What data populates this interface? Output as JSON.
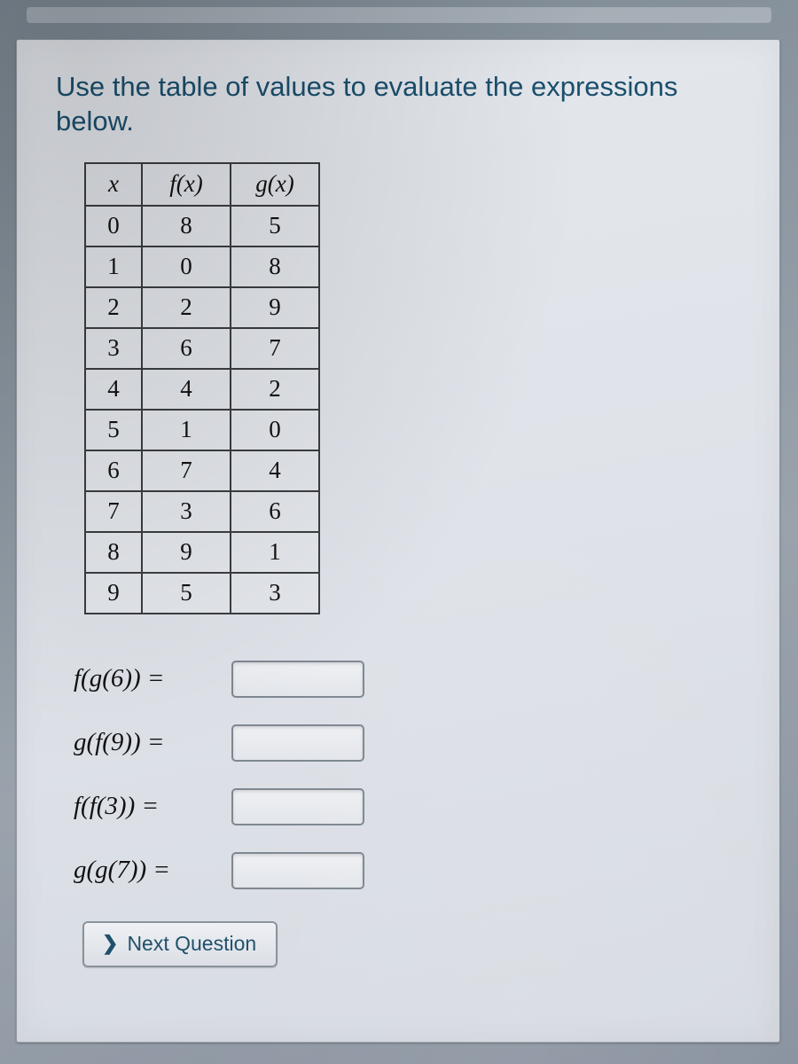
{
  "prompt": "Use the table of values to evaluate the expressions below.",
  "table": {
    "headers": {
      "x": "x",
      "fx": "f(x)",
      "gx": "g(x)"
    },
    "rows": [
      {
        "x": "0",
        "fx": "8",
        "gx": "5"
      },
      {
        "x": "1",
        "fx": "0",
        "gx": "8"
      },
      {
        "x": "2",
        "fx": "2",
        "gx": "9"
      },
      {
        "x": "3",
        "fx": "6",
        "gx": "7"
      },
      {
        "x": "4",
        "fx": "4",
        "gx": "2"
      },
      {
        "x": "5",
        "fx": "1",
        "gx": "0"
      },
      {
        "x": "6",
        "fx": "7",
        "gx": "4"
      },
      {
        "x": "7",
        "fx": "3",
        "gx": "6"
      },
      {
        "x": "8",
        "fx": "9",
        "gx": "1"
      },
      {
        "x": "9",
        "fx": "5",
        "gx": "3"
      }
    ]
  },
  "expressions": [
    {
      "label": "f(g(6)) =",
      "value": ""
    },
    {
      "label": "g(f(9)) =",
      "value": ""
    },
    {
      "label": "f(f(3)) =",
      "value": ""
    },
    {
      "label": "g(g(7)) =",
      "value": ""
    }
  ],
  "next_button": "Next Question"
}
